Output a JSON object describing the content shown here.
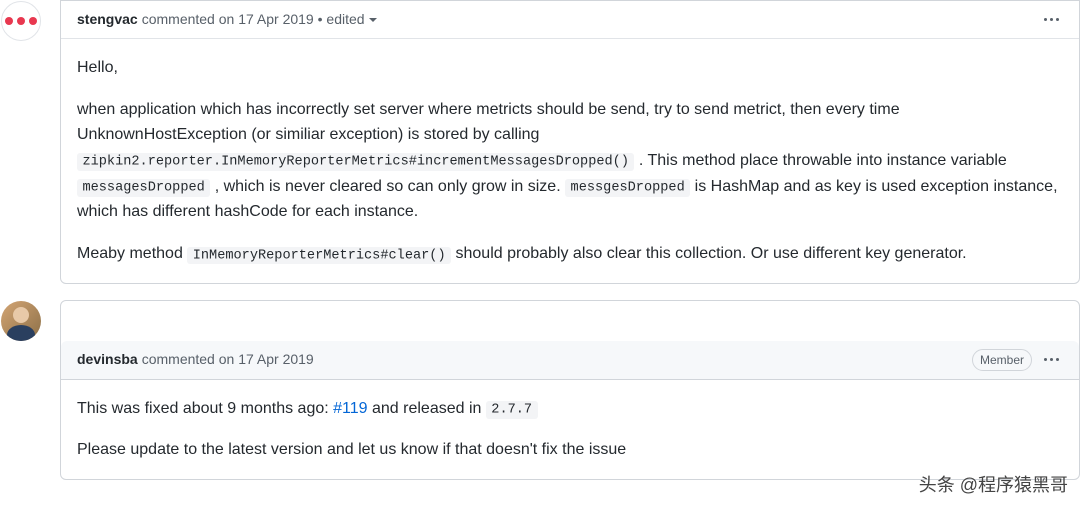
{
  "comments": [
    {
      "author": "stengvac",
      "meta": "commented on 17 Apr 2019",
      "edited": "edited",
      "body": {
        "p1": "Hello,",
        "p2a": "when application which has incorrectly set server where metricts should be send, try to send metrict, then every time UnknownHostException (or similiar exception) is stored by calling ",
        "code1": "zipkin2.reporter.InMemoryReporterMetrics#incrementMessagesDropped()",
        "p2b": ". This method place throwable into instance variable ",
        "code2": "messagesDropped",
        "p2c": ", which is never cleared so can only grow in size. ",
        "code3": "messgesDropped",
        "p2d": " is HashMap and as key is used exception instance, which has different hashCode for each instance.",
        "p3a": "Meaby method ",
        "code4": "InMemoryReporterMetrics#clear()",
        "p3b": " should probably also clear this collection. Or use different key generator."
      }
    },
    {
      "author": "devinsba",
      "meta": "commented on 17 Apr 2019",
      "badge": "Member",
      "body": {
        "p1a": "This was fixed about 9 months ago: ",
        "link": "#119",
        "p1b": " and released in ",
        "code1": "2.7.7",
        "p2": "Please update to the latest version and let us know if that doesn't fix the issue"
      }
    }
  ],
  "watermark": "头条 @程序猿黑哥"
}
